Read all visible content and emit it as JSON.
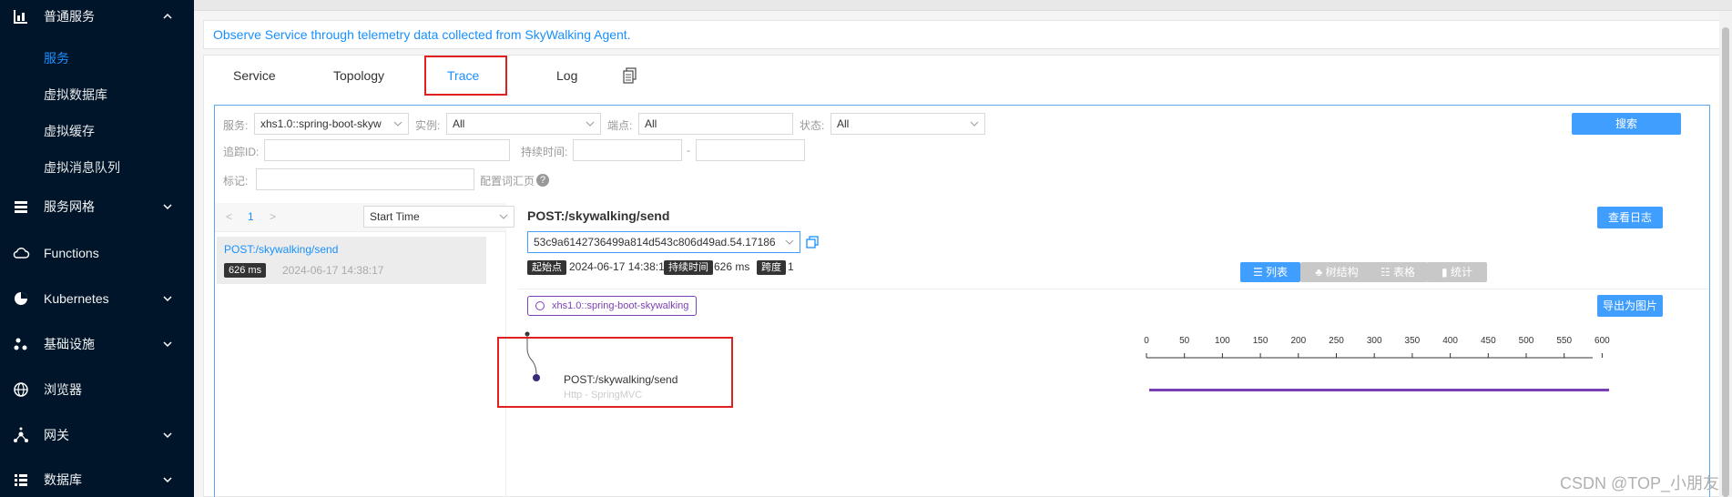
{
  "sidebar": {
    "groups": [
      {
        "label": "普通服务",
        "icon": "bar-chart-icon",
        "expanded": true
      },
      {
        "label": "服务网格",
        "icon": "stack-icon"
      },
      {
        "label": "Functions",
        "icon": "cloud-icon"
      },
      {
        "label": "Kubernetes",
        "icon": "pie-icon"
      },
      {
        "label": "基础设施",
        "icon": "nodes-icon"
      },
      {
        "label": "浏览器",
        "icon": "globe-icon"
      },
      {
        "label": "网关",
        "icon": "gateway-icon"
      },
      {
        "label": "数据库",
        "icon": "list-icon"
      }
    ],
    "sub_items": [
      "服务",
      "虚拟数据库",
      "虚拟缓存",
      "虚拟消息队列"
    ],
    "active_sub": "服务"
  },
  "alert_text": "Observe Service through telemetry data collected from SkyWalking Agent.",
  "tabs": [
    "Service",
    "Topology",
    "Trace",
    "Log"
  ],
  "active_tab": "Trace",
  "filters": {
    "service_label": "服务:",
    "service_value": "xhs1.0::spring-boot-skyw",
    "instance_label": "实例:",
    "instance_value": "All",
    "endpoint_label": "端点:",
    "endpoint_value": "All",
    "status_label": "状态:",
    "status_value": "All",
    "trace_id_label": "追踪ID:",
    "duration_label": "持续时间:",
    "duration_sep": "-",
    "tags_label": "标记:",
    "tags_help": "配置词汇页",
    "search_button": "搜索"
  },
  "trace_list": {
    "page": "1",
    "prev": "<",
    "next": ">",
    "sort_value": "Start Time",
    "items": [
      {
        "endpoint": "POST:/skywalking/send",
        "duration": "626 ms",
        "time": "2024-06-17 14:38:17"
      }
    ]
  },
  "detail": {
    "title": "POST:/skywalking/send",
    "view_logs": "查看日志",
    "trace_id": "53c9a6142736499a814d543c806d49ad.54.17186",
    "start_tag": "起始点",
    "start_time": "2024-06-17 14:38:17",
    "duration_tag": "持续时间",
    "duration": "626 ms",
    "span_tag": "跨度",
    "span_count": "1",
    "view_buttons": [
      "列表",
      "树结构",
      "表格",
      "统计"
    ],
    "active_view": "列表",
    "export_button": "导出为图片",
    "service_badge": "xhs1.0::spring-boot-skywalking",
    "axis_ticks": [
      "0",
      "50",
      "100",
      "150",
      "200",
      "250",
      "300",
      "350",
      "400",
      "450",
      "500",
      "550",
      "600"
    ],
    "span_name": "POST:/skywalking/send",
    "span_sub": "Http - SpringMVC",
    "bar_color": "#7b3fb5",
    "span_start_ms": 0,
    "span_duration_ms": 626
  },
  "watermark": "CSDN @TOP_小朋友"
}
